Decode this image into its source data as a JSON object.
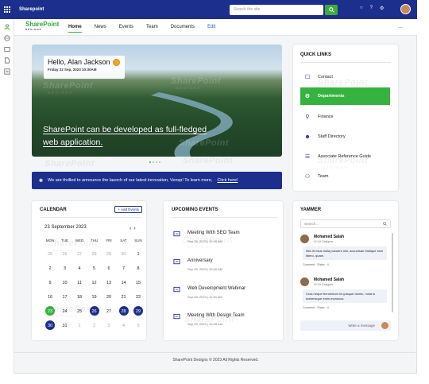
{
  "topbar": {
    "site_name": "Sharepoint",
    "search_placeholder": "Search the site"
  },
  "logo": {
    "main": "SharePoint",
    "sub": "DESIGNS"
  },
  "nav": {
    "items": [
      "Home",
      "News",
      "Events",
      "Team",
      "Documents",
      "Edit"
    ],
    "more": "..."
  },
  "hero": {
    "greeting": "Hello, Alan Jackson",
    "datetime": "Friday 22 Sep, 2023   10:30AM",
    "caption_line1": "SharePoint can be developed as full-fledged",
    "caption_line2": "web application."
  },
  "announcement": {
    "text": "We are thrilled to announce the launch of our latest innovation, Vensp! To learn more,",
    "link": "Click here!"
  },
  "quick_links": {
    "title": "QUICK LINKS",
    "items": [
      {
        "label": "Contact",
        "icon": "contact-book-icon"
      },
      {
        "label": "Departments",
        "icon": "departments-icon"
      },
      {
        "label": "Finance",
        "icon": "finance-bag-icon"
      },
      {
        "label": "Staff Directory",
        "icon": "staff-directory-icon"
      },
      {
        "label": "Associate Reference Guide",
        "icon": "reference-guide-icon"
      },
      {
        "label": "Team",
        "icon": "team-icon"
      }
    ]
  },
  "calendar": {
    "title": "CALENDAR",
    "add_button": "+ Add Events",
    "month": "23 September 2023",
    "prev": "‹",
    "next": "›",
    "weekdays": [
      "MON",
      "TUE",
      "WED",
      "THU",
      "FRI",
      "SAT",
      "SUN"
    ],
    "weeks": [
      [
        "25",
        "26",
        "27",
        "28",
        "29",
        "30",
        "1"
      ],
      [
        "2",
        "3",
        "4",
        "5",
        "6",
        "7",
        "8"
      ],
      [
        "9",
        "10",
        "11",
        "12",
        "13",
        "14",
        "15"
      ],
      [
        "16",
        "17",
        "18",
        "19",
        "20",
        "21",
        "22"
      ],
      [
        "23",
        "24",
        "25",
        "26",
        "27",
        "28",
        "29"
      ],
      [
        "30",
        "31",
        "1",
        "2",
        "3",
        "4",
        "5"
      ]
    ],
    "muted_first_row": 6,
    "muted_last_row_from": 2,
    "highlight_green": [
      "23"
    ],
    "highlight_blue": [
      "26",
      "28",
      "29",
      "30"
    ],
    "colors": {
      "green": "#35b23f",
      "blue": "#1d2f8c"
    }
  },
  "upcoming_events": {
    "title": "UPCOMING EVENTS",
    "items": [
      {
        "title": "Meeting With SEO Team",
        "date": "Sep 26, 2023 | 10:00 AM",
        "icon": "presentation-icon"
      },
      {
        "title": "Anniversary",
        "date": "Sep 28, 2023 | 10:00 AM",
        "icon": "anniversary-icon"
      },
      {
        "title": "Web Development Webinar",
        "date": "Sep 28, 2023 | 11:30 AM",
        "icon": "webinar-icon"
      },
      {
        "title": "Meeting With Design Team",
        "date": "Sep 29, 2023 | 10:00 AM",
        "icon": "presentation-icon"
      }
    ]
  },
  "yammer": {
    "title": "YAMMER",
    "search_placeholder": "Search...",
    "posts": [
      {
        "name": "Mohamed Salah",
        "role": "UI UX Designer",
        "body": "Nec lit risus nulla posuere nisi, accumsan tristique sem libero, quam.",
        "actions": "Comment  ·  Share  ·  4"
      },
      {
        "name": "Mohamed Salah",
        "role": "UI UX Designer",
        "body": "Cras neque fermentum id quisque donec, nulla in scelerisque enim monocus.",
        "actions": "Comment  ·  Share  ·  4"
      }
    ],
    "compose_placeholder": "Write a message"
  },
  "footer": {
    "text": "SharePoint Designs © 2023 All Rights Reserved."
  },
  "colors": {
    "brand_blue": "#1d2f8c",
    "brand_green": "#35b23f"
  }
}
